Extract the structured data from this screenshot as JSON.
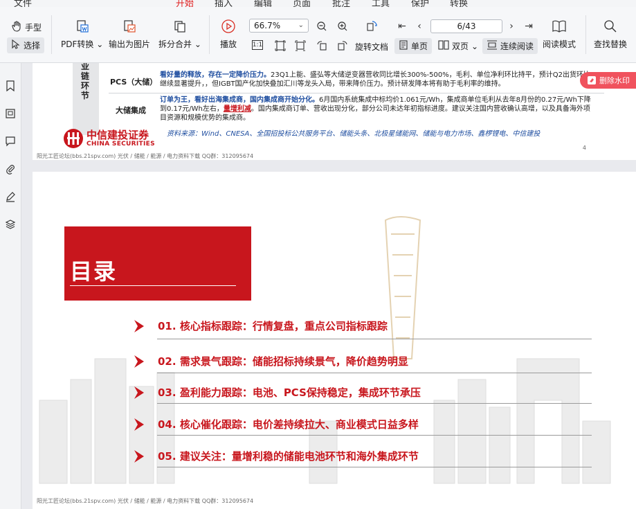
{
  "menubar": {
    "items": [
      {
        "label": "文件"
      },
      {
        "label": "开始",
        "active": true
      },
      {
        "label": "插入"
      },
      {
        "label": "编辑"
      },
      {
        "label": "页面"
      },
      {
        "label": "批注"
      },
      {
        "label": "工具"
      },
      {
        "label": "保护"
      },
      {
        "label": "转换"
      }
    ]
  },
  "toolbar": {
    "hand": "手型",
    "select": "选择",
    "pdf_convert": "PDF转换",
    "export_image": "输出为图片",
    "split_merge": "拆分合并",
    "play": "播放",
    "zoom_value": "66.7%",
    "rotate_doc": "旋转文档",
    "page_counter": "6/43",
    "single_page": "单页",
    "double_page": "双页",
    "continuous": "连续阅读",
    "read_mode": "阅读模式",
    "find_replace": "查找替换",
    "actual_size_label": "1:1"
  },
  "watermark_button": {
    "label": "删除水印"
  },
  "page1": {
    "side_label": "业链环节",
    "rows": [
      {
        "label": "PCS（大储）",
        "highlight": "看好量的释放，存在一定降价压力。",
        "text": "23Q1上能、盛弘等大储逆变器营收同比增长300%-500%，毛利、单位净利环比持平，预计Q2出货环比继续显著提升，，但IGBT国产化加快叠加汇川等龙头入局，带来降价压力。预计研发降本将有助于毛利率的维持。"
      },
      {
        "label": "大储集成",
        "highlight": "订单为王，看好出海集成商，国内集成商开始分化。",
        "text_a": "6月国内系统集成中标均价1.061元/Wh，集成商单位毛利从去年8月份的0.27元/Wh下降到0.17元/Wh左右，",
        "underline": "量增利减",
        "text_b": "。国内集成商订单、营收出现分化，部分公司未达年初指标进度。建议关注国内营收确认高增，以及具备海外项目资源和规模优势的集成商。"
      }
    ],
    "source": "资料来源：Wind、CNESA、全国招投标公共服务平台、储能头条、北极星储能网、储能与电力市场、鑫椤锂电、中信建投",
    "logo_cn": "中信建投证券",
    "logo_en": "CHINA SECURITIES",
    "page_number": "4",
    "footer": "阳光工匠论坛(bbs.21spv.com)       光伏 / 储能 / 能源 / 电力资料下载       QQ群：312095674"
  },
  "page2": {
    "toc_title": "目录",
    "toc": [
      {
        "num": "01.",
        "text": "核心指标跟踪：行情复盘，重点公司指标跟踪"
      },
      {
        "num": "02.",
        "text": "需求景气跟踪：储能招标持续景气，降价趋势明显"
      },
      {
        "num": "03.",
        "text": "盈利能力跟踪：电池、PCS保持稳定，集成环节承压"
      },
      {
        "num": "04.",
        "text": "核心催化跟踪：电价差持续拉大、商业模式日益多样"
      },
      {
        "num": "05.",
        "text": "建议关注：量增利稳的储能电池环节和海外集成环节"
      }
    ],
    "footer": "阳光工匠论坛(bbs.21spv.com)       光伏 / 储能 / 能源 / 电力资料下载       QQ群：312095674"
  },
  "colors": {
    "accent": "#c8161d",
    "blue_text": "#1f4ea0",
    "watermark_btn": "#f0525d"
  },
  "rail_icons": [
    "bookmark-icon",
    "thumbnail-icon",
    "comment-icon",
    "attachment-icon",
    "signature-icon",
    "layers-icon"
  ]
}
